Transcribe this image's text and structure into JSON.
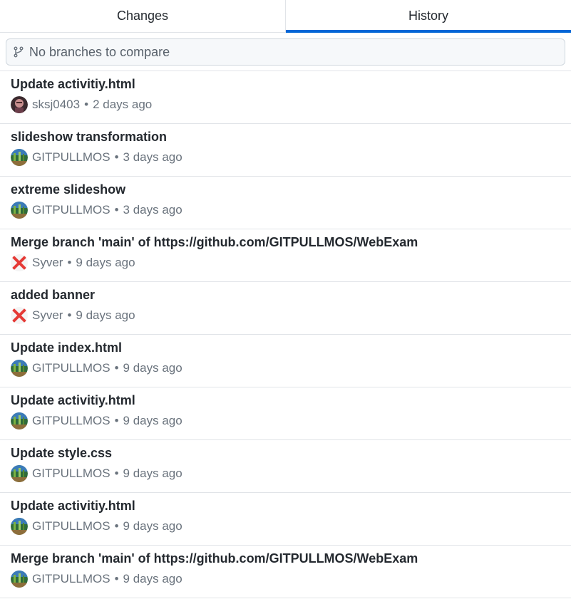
{
  "tabs": [
    {
      "label": "Changes",
      "active": false
    },
    {
      "label": "History",
      "active": true
    }
  ],
  "compare": {
    "placeholder": "No branches to compare",
    "icon": "git-branch-icon"
  },
  "colors": {
    "accent": "#0366d6",
    "border": "#e1e4e8",
    "meta_text": "#6a737d"
  },
  "separator": "•",
  "commits": [
    {
      "summary": "Update activitiy.html",
      "author": "sksj0403",
      "time": "2 days ago",
      "avatar": "person-photo"
    },
    {
      "summary": "slideshow transformation",
      "author": "GITPULLMOS",
      "time": "3 days ago",
      "avatar": "landscape"
    },
    {
      "summary": "extreme slideshow",
      "author": "GITPULLMOS",
      "time": "3 days ago",
      "avatar": "landscape"
    },
    {
      "summary": "Merge branch 'main' of https://github.com/GITPULLMOS/WebExam",
      "author": "Syver",
      "time": "9 days ago",
      "avatar": "red-x"
    },
    {
      "summary": "added banner",
      "author": "Syver",
      "time": "9 days ago",
      "avatar": "red-x"
    },
    {
      "summary": "Update index.html",
      "author": "GITPULLMOS",
      "time": "9 days ago",
      "avatar": "landscape"
    },
    {
      "summary": "Update activitiy.html",
      "author": "GITPULLMOS",
      "time": "9 days ago",
      "avatar": "landscape"
    },
    {
      "summary": "Update style.css",
      "author": "GITPULLMOS",
      "time": "9 days ago",
      "avatar": "landscape"
    },
    {
      "summary": "Update activitiy.html",
      "author": "GITPULLMOS",
      "time": "9 days ago",
      "avatar": "landscape"
    },
    {
      "summary": "Merge branch 'main' of https://github.com/GITPULLMOS/WebExam",
      "author": "GITPULLMOS",
      "time": "9 days ago",
      "avatar": "landscape"
    }
  ]
}
